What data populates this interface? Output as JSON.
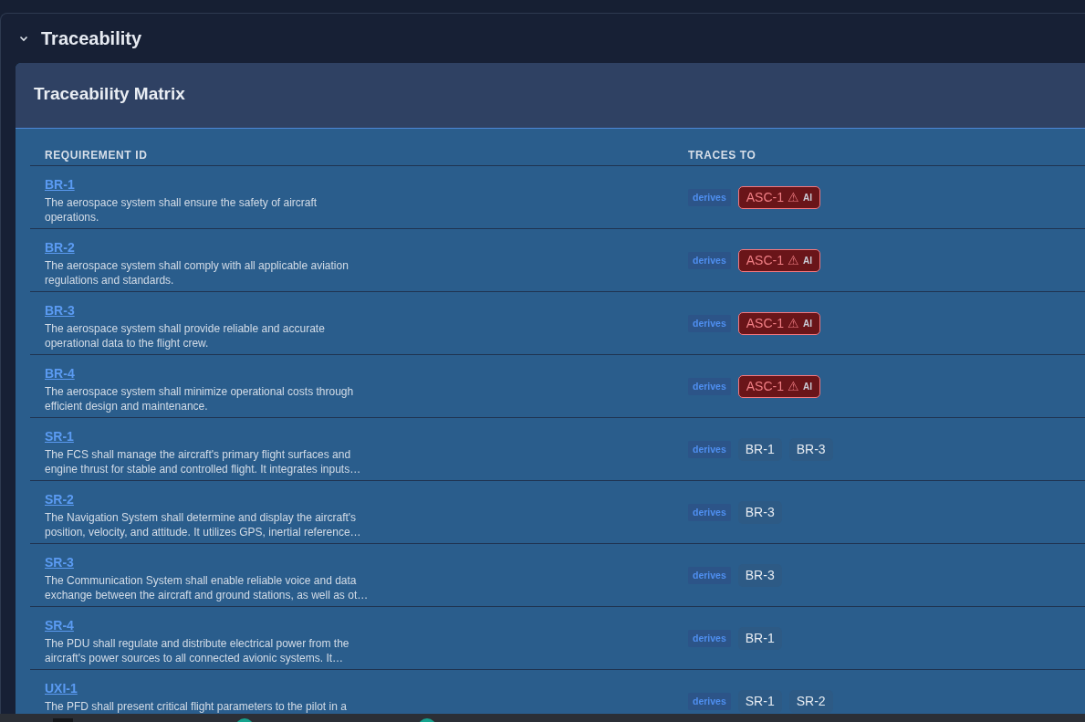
{
  "section": {
    "title": "Traceability",
    "expanded": true
  },
  "card": {
    "title": "Traceability Matrix"
  },
  "table": {
    "columns": [
      "REQUIREMENT ID",
      "TRACES TO"
    ],
    "rows": [
      {
        "id": "BR-1",
        "description": "The aerospace system shall ensure the safety of aircraft operations.",
        "relation": "derives",
        "targets": [
          {
            "label": "ASC-1",
            "kind": "warning",
            "warn": "⚠",
            "tag": "AI"
          }
        ]
      },
      {
        "id": "BR-2",
        "description": "The aerospace system shall comply with all applicable aviation regulations and standards.",
        "relation": "derives",
        "targets": [
          {
            "label": "ASC-1",
            "kind": "warning",
            "warn": "⚠",
            "tag": "AI"
          }
        ]
      },
      {
        "id": "BR-3",
        "description": "The aerospace system shall provide reliable and accurate operational data to the flight crew.",
        "relation": "derives",
        "targets": [
          {
            "label": "ASC-1",
            "kind": "warning",
            "warn": "⚠",
            "tag": "AI"
          }
        ]
      },
      {
        "id": "BR-4",
        "description": "The aerospace system shall minimize operational costs through efficient design and maintenance.",
        "relation": "derives",
        "targets": [
          {
            "label": "ASC-1",
            "kind": "warning",
            "warn": "⚠",
            "tag": "AI"
          }
        ]
      },
      {
        "id": "SR-1",
        "description": "The FCS shall manage the aircraft's primary flight surfaces and engine thrust for stable and controlled flight. It integrates inputs…",
        "relation": "derives",
        "targets": [
          {
            "label": "BR-1",
            "kind": "plain"
          },
          {
            "label": "BR-3",
            "kind": "plain"
          }
        ]
      },
      {
        "id": "SR-2",
        "description": "The Navigation System shall determine and display the aircraft's position, velocity, and attitude. It utilizes GPS, inertial reference…",
        "relation": "derives",
        "targets": [
          {
            "label": "BR-3",
            "kind": "plain"
          }
        ]
      },
      {
        "id": "SR-3",
        "description": "The Communication System shall enable reliable voice and data exchange between the aircraft and ground stations, as well as ot…",
        "relation": "derives",
        "targets": [
          {
            "label": "BR-3",
            "kind": "plain"
          }
        ]
      },
      {
        "id": "SR-4",
        "description": "The PDU shall regulate and distribute electrical power from the aircraft's power sources to all connected avionic systems. It…",
        "relation": "derives",
        "targets": [
          {
            "label": "BR-1",
            "kind": "plain"
          }
        ]
      },
      {
        "id": "UXI-1",
        "description": "The PFD shall present critical flight parameters to the pilot in a",
        "relation": "derives",
        "targets": [
          {
            "label": "SR-1",
            "kind": "plain"
          },
          {
            "label": "SR-2",
            "kind": "plain"
          }
        ]
      }
    ]
  }
}
